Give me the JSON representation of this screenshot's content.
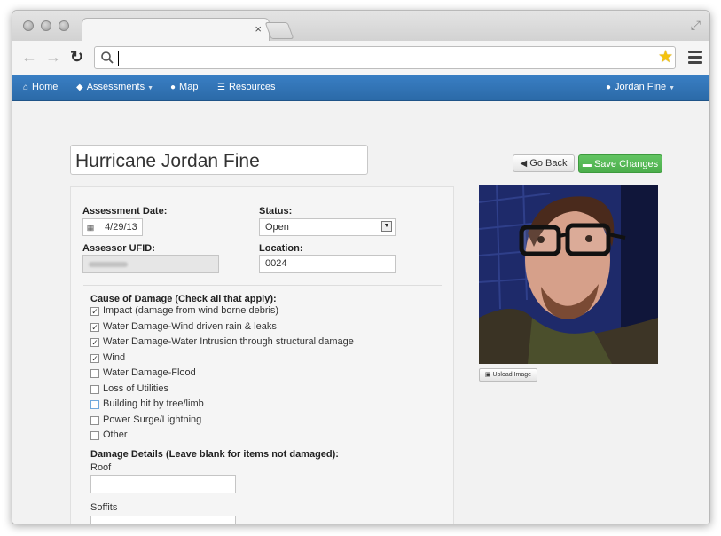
{
  "browser": {
    "tab_close": "×",
    "url": ""
  },
  "nav": {
    "home": "Home",
    "assessments": "Assessments",
    "map": "Map",
    "resources": "Resources",
    "user": "Jordan Fine"
  },
  "page": {
    "title": "Hurricane Jordan Fine",
    "go_back": "Go Back",
    "save_changes": "Save Changes",
    "upload_image": "Upload Image"
  },
  "form": {
    "assessment_date_label": "Assessment Date:",
    "assessment_date_value": "4/29/13",
    "status_label": "Status:",
    "status_value": "Open",
    "assessor_label": "Assessor UFID:",
    "location_label": "Location:",
    "location_value": "0024",
    "cause_label": "Cause of Damage (Check all that apply):",
    "causes": [
      {
        "label": "Impact (damage from wind borne debris)",
        "checked": true
      },
      {
        "label": "Water Damage-Wind driven rain & leaks",
        "checked": true
      },
      {
        "label": "Water Damage-Water Intrusion through structural damage",
        "checked": true
      },
      {
        "label": "Wind",
        "checked": true
      },
      {
        "label": "Water Damage-Flood",
        "checked": false
      },
      {
        "label": "Loss of Utilities",
        "checked": false
      },
      {
        "label": "Building hit by tree/limb",
        "checked": false
      },
      {
        "label": "Power Surge/Lightning",
        "checked": false
      },
      {
        "label": "Other",
        "checked": false
      }
    ],
    "details_label": "Damage Details (Leave blank for items not damaged):",
    "roof_label": "Roof",
    "soffits_label": "Soffits"
  },
  "colors": {
    "nav_bg": "#2f72b3",
    "save_button": "#5cb85c",
    "focused_checkbox": "#6fa8dc"
  }
}
